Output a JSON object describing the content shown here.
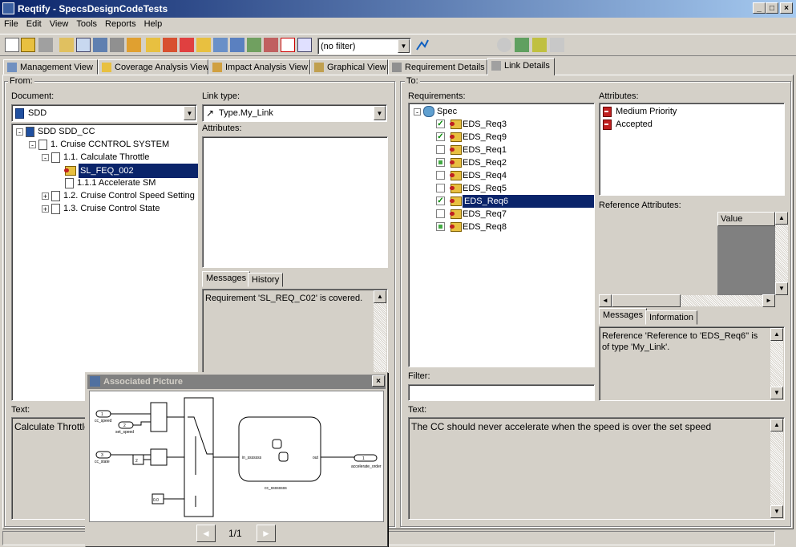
{
  "window": {
    "title": "Reqtify - SpecsDesignCodeTests"
  },
  "menu": [
    "File",
    "Edit",
    "View",
    "Tools",
    "Reports",
    "Help"
  ],
  "toolbar": {
    "filter_value": "(no filter)"
  },
  "tabs": [
    {
      "label": "Management View",
      "active": false
    },
    {
      "label": "Coverage Analysis View",
      "active": false
    },
    {
      "label": "Impact Analysis View",
      "active": false
    },
    {
      "label": "Graphical View",
      "active": false
    },
    {
      "label": "Requirement Details",
      "active": false
    },
    {
      "label": "Link Details",
      "active": true
    }
  ],
  "from": {
    "group_label": "From:",
    "document_label": "Document:",
    "document_value": "SDD",
    "tree": [
      {
        "label": "SDD    SDD_CC",
        "level": 0,
        "expander": "-",
        "icon": "word-doc-icon"
      },
      {
        "label": "1. Cruise CCNTROL SYSTEM",
        "level": 1,
        "expander": "-",
        "icon": "page-icon"
      },
      {
        "label": "1.1. Calculate Throttle",
        "level": 2,
        "expander": "-",
        "icon": "page-icon"
      },
      {
        "label": "SL_FEQ_002",
        "level": 3,
        "expander": "",
        "icon": "requirement-icon",
        "selected": true
      },
      {
        "label": "1.1.1 Accelerate SM",
        "level": 3,
        "expander": "",
        "icon": "page-icon"
      },
      {
        "label": "1.2. Cruise Control Speed Setting",
        "level": 2,
        "expander": "+",
        "icon": "page-icon"
      },
      {
        "label": "1.3. Cruise Control State",
        "level": 2,
        "expander": "+",
        "icon": "page-icon"
      }
    ],
    "link_type_label": "Link type:",
    "link_type_value": "Type.My_Link",
    "attributes_label": "Attributes:",
    "messages_tab": "Messages",
    "history_tab": "History",
    "message_text": "Requirement 'SL_REQ_C02' is covered.",
    "text_label": "Text:",
    "text_value": "Calculate Throttle :"
  },
  "to": {
    "group_label": "To:",
    "requirements_label": "Requirements:",
    "root": "Spec",
    "requirements": [
      {
        "label": "EDS_Req3",
        "check": "checked",
        "selected": false
      },
      {
        "label": "EDS_Req9",
        "check": "checked",
        "selected": false
      },
      {
        "label": "EDS_Req1",
        "check": "none",
        "selected": false
      },
      {
        "label": "EDS_Req2",
        "check": "partial",
        "selected": false
      },
      {
        "label": "EDS_Req4",
        "check": "none",
        "selected": false
      },
      {
        "label": "EDS_Req5",
        "check": "none",
        "selected": false
      },
      {
        "label": "EDS_Req6",
        "check": "checked",
        "selected": true
      },
      {
        "label": "EDS_Req7",
        "check": "none",
        "selected": false
      },
      {
        "label": "EDS_Req8",
        "check": "partial",
        "selected": false
      }
    ],
    "attributes_label": "Attributes:",
    "attributes": [
      "Medium Priority",
      "Accepted"
    ],
    "reference_attributes_label": "Reference Attributes:",
    "value_header": "Value",
    "messages_tab": "Messages",
    "information_tab": "Information",
    "message_text": "Reference 'Reference to 'EDS_Req6'' is of type 'My_Link'.",
    "filter_label": "Filter:",
    "filter_value": "",
    "text_label": "Text:",
    "text_value": "The CC should never accelerate when the speed is over the set speed"
  },
  "popup": {
    "title": "Associated Picture",
    "page": "1/1",
    "diagram": {
      "inputs": [
        "cc_speed",
        "set_speed",
        "cc_state"
      ],
      "constant": "2",
      "constant2": "0.0",
      "chart_block": "cc_ssssssss",
      "chart_in": "in_sssssss",
      "chart_out": "out",
      "output": "accelerate_order",
      "in_num": [
        "1",
        "2",
        "3"
      ],
      "out_num": "1"
    }
  }
}
